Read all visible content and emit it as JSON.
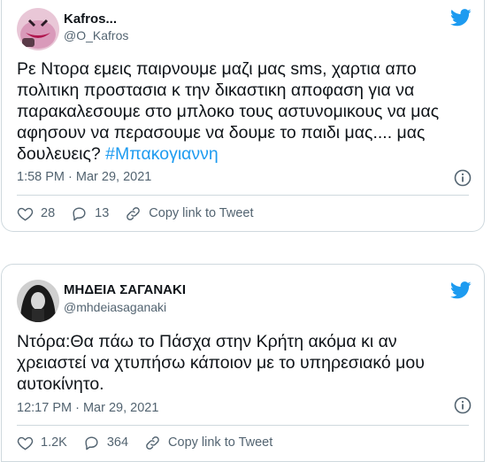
{
  "colors": {
    "accent": "#1d9bf0",
    "text": "#0f1419",
    "muted": "#536471",
    "border": "#cfd9de"
  },
  "tweets": [
    {
      "name": "Kafros...",
      "handle": "@O_Kafros",
      "text_lines": [
        "Ρε Ντορα εμεις παιρνουμε μαζι μας sms, χαρτια απο",
        "πολιτικη προστασια κ την δικαστικη αποφαση για να",
        "παρακαλεσουμε στο μπλοκο τους αστυνομικους να μας",
        "αφησουν να περασουμε να δουμε το παιδι μας.... μας",
        "δουλευεις?"
      ],
      "hashtag": "#Μπακογιαννη",
      "time": "1:58 PM · Mar 29, 2021",
      "likes": "28",
      "replies": "13",
      "copy_link": "Copy link to Tweet"
    },
    {
      "name": "ΜΗΔΕΙΑ ΣΑΓΑΝΑΚΙ",
      "handle": "@mhdeiasaganaki",
      "text_lines": [
        "Ντόρα:Θα πάω το Πάσχα στην Κρήτη ακόμα κι αν",
        "χρειαστεί να χτυπήσω κάποιον με το υπηρεσιακό μου",
        "αυτοκίνητο."
      ],
      "time": "12:17 PM · Mar 29, 2021",
      "likes": "1.2K",
      "replies": "364",
      "copy_link": "Copy link to Tweet"
    }
  ]
}
